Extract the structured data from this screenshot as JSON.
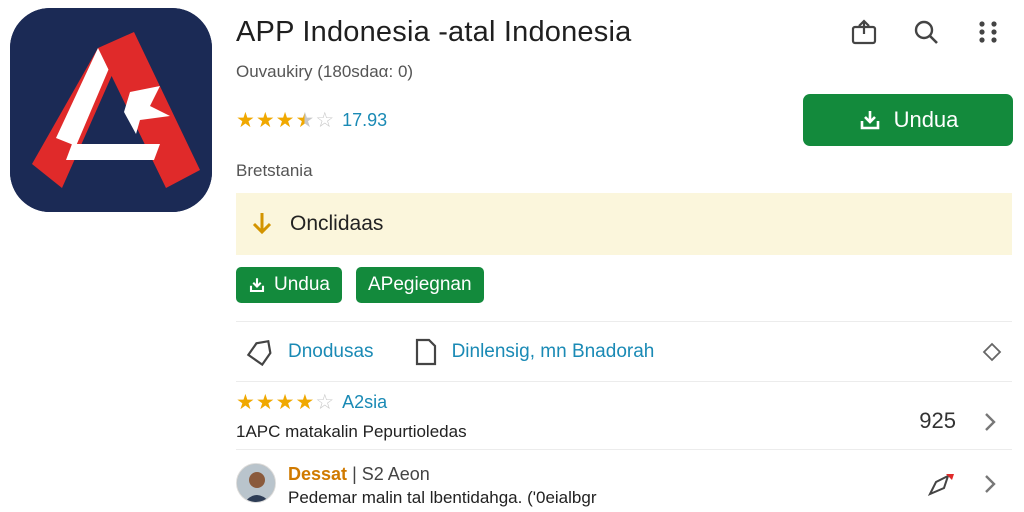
{
  "app": {
    "title": "APP Indonesia -atal  Indonesia",
    "subtitle": "Ouvaukiry (180sdaα: 0)",
    "rating_value": "17.93",
    "category": "Bretstania",
    "install_label": "Undua"
  },
  "top_actions": [
    "share-icon",
    "search-icon",
    "more-icon"
  ],
  "notice": {
    "text": "Onclidaas"
  },
  "tags": [
    {
      "label": "Undua"
    },
    {
      "label": "APegiegnan"
    }
  ],
  "links": {
    "first": "Dnodusas",
    "second": "Dinlensig, mn Bnadorah"
  },
  "review": {
    "stars": 4,
    "label": "A2sia",
    "text": "1APC  matakalin  Pepurtioledas",
    "count": "925"
  },
  "comment": {
    "name": "Dessat",
    "meta": "S2 Aeon",
    "text": "Pedemar malin tal lbentidahga. ('0eialbgr"
  },
  "colors": {
    "accent_green": "#138a3c",
    "link_blue": "#1a8ab5",
    "star": "#f0a800",
    "notice_bg": "#fbf6dc",
    "icon_navy": "#1b2a55",
    "icon_red": "#e02a2a"
  }
}
